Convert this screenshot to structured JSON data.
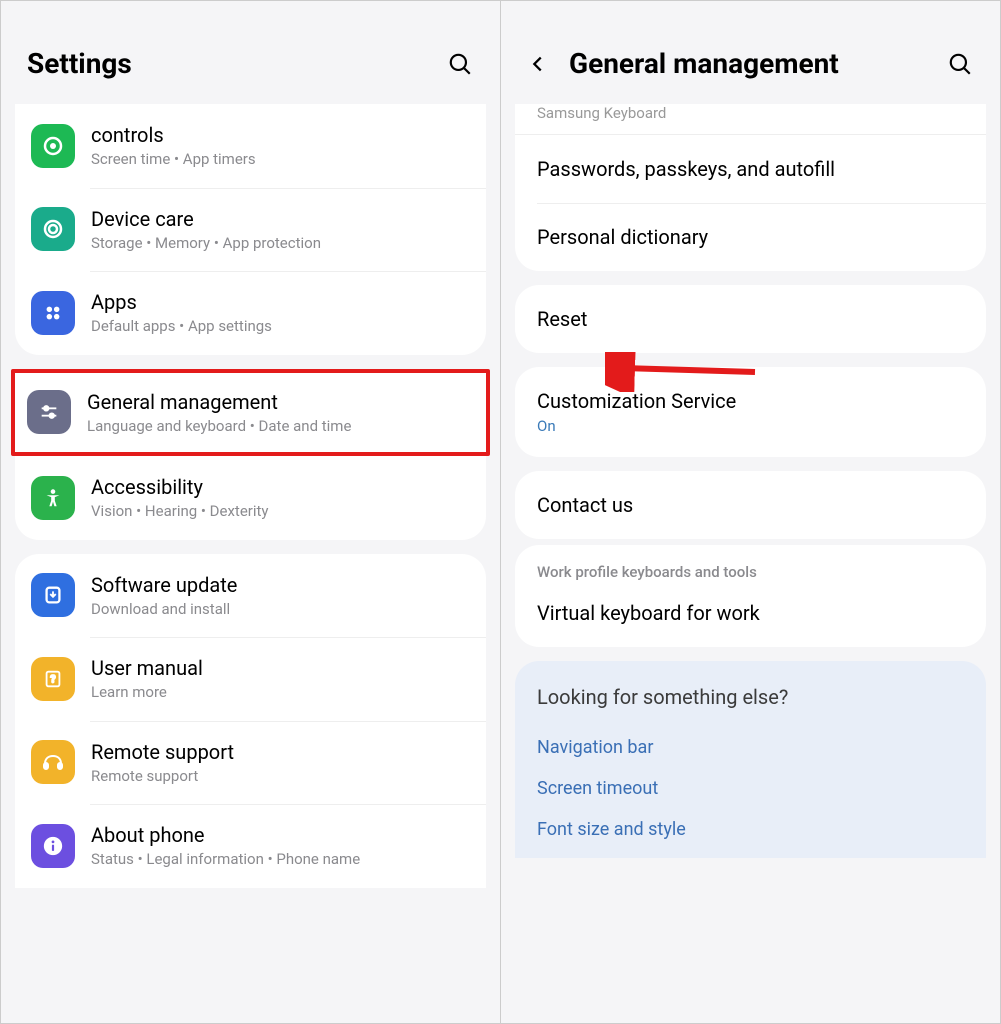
{
  "left": {
    "title": "Settings",
    "group1": {
      "row0": {
        "title": "controls",
        "subtitle": "Screen time  •  App timers"
      },
      "row1": {
        "title": "Device care",
        "subtitle": "Storage  •  Memory  •  App protection"
      },
      "row2": {
        "title": "Apps",
        "subtitle": "Default apps  •  App settings"
      }
    },
    "group2": {
      "row0": {
        "title": "General management",
        "subtitle": "Language and keyboard  •  Date and time"
      },
      "row1": {
        "title": "Accessibility",
        "subtitle": "Vision  •  Hearing  •  Dexterity"
      }
    },
    "group3": {
      "row0": {
        "title": "Software update",
        "subtitle": "Download and install"
      },
      "row1": {
        "title": "User manual",
        "subtitle": "Learn more"
      },
      "row2": {
        "title": "Remote support",
        "subtitle": "Remote support"
      },
      "row3": {
        "title": "About phone",
        "subtitle": "Status  •  Legal information  •  Phone name"
      }
    }
  },
  "right": {
    "title": "General management",
    "partial_row": "Samsung Keyboard",
    "group1": {
      "row0": {
        "title": "Passwords, passkeys, and autofill"
      },
      "row1": {
        "title": "Personal dictionary"
      }
    },
    "group2": {
      "row0": {
        "title": "Reset"
      }
    },
    "group3": {
      "row0": {
        "title": "Customization Service",
        "status": "On"
      }
    },
    "group4": {
      "row0": {
        "title": "Contact us"
      }
    },
    "section_header": "Work profile keyboards and tools",
    "group5": {
      "row0": {
        "title": "Virtual keyboard for work"
      }
    },
    "suggestions": {
      "title": "Looking for something else?",
      "links": [
        "Navigation bar",
        "Screen timeout",
        "Font size and style"
      ]
    }
  },
  "colors": {
    "green": "#1db954",
    "teal": "#1aab8b",
    "blue": "#3a66e0",
    "slate": "#6b6e8a",
    "green2": "#2bb24c",
    "blue2": "#2f6fe0",
    "amber": "#f2b32a",
    "amber2": "#f2b32a",
    "purple": "#6c4fe0"
  }
}
